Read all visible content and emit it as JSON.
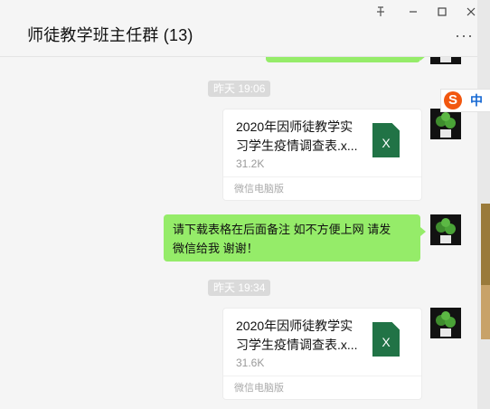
{
  "window": {
    "title": "师徒教学班主任群 (13)",
    "controls": {
      "pin_glyph": "✇",
      "minimize_glyph": "—",
      "maximize_glyph": "☐",
      "close_glyph": "✕"
    },
    "more_glyph": "···"
  },
  "messages": [
    {
      "type": "timestamp",
      "text": "昨天 19:06"
    },
    {
      "type": "file",
      "name": "2020年因师徒教学实习学生疫情调查表.x...",
      "size": "31.2K",
      "source": "微信电脑版",
      "icon_label": "X"
    },
    {
      "type": "text",
      "text_line1": "请下载表格在后面备注  如不方便上网 请发",
      "text_line2": "微信给我 谢谢！"
    },
    {
      "type": "timestamp",
      "text": "昨天 19:34"
    },
    {
      "type": "file",
      "name": "2020年因师徒教学实习学生疫情调查表.x...",
      "size": "31.6K",
      "source": "微信电脑版",
      "icon_label": "X"
    }
  ],
  "ime": {
    "logo": "S",
    "mode": "中"
  },
  "colors": {
    "own_bubble": "#95ec69",
    "background": "#f5f5f5",
    "excel_green": "#217346",
    "sogou_orange": "#f2570f",
    "ime_blue": "#1769d3"
  },
  "icons": [
    "pin-icon",
    "minimize-icon",
    "maximize-icon",
    "close-icon",
    "more-icon",
    "excel-file-icon",
    "plant-avatar-icon",
    "sogou-ime-icon"
  ]
}
